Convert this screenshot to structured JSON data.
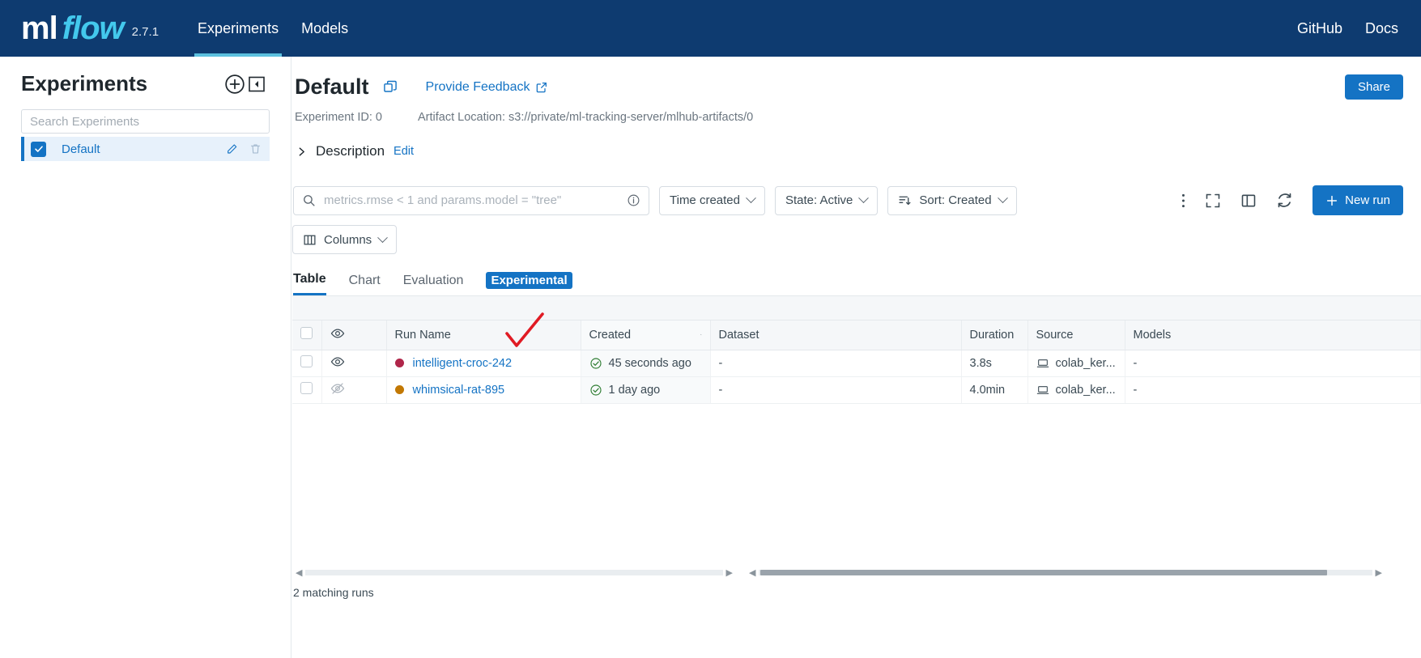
{
  "topbar": {
    "logo_ml": "ml",
    "logo_flow": "flow",
    "version": "2.7.1",
    "nav": [
      {
        "label": "Experiments",
        "icon": "experiments-icon",
        "active": true
      },
      {
        "label": "Models",
        "icon": "models-icon",
        "active": false
      }
    ],
    "right_links": [
      {
        "label": "GitHub",
        "icon": "github-link-icon"
      },
      {
        "label": "Docs",
        "icon": "docs-link-icon"
      }
    ],
    "background": "#0e3b70",
    "accent": "#43c9ed"
  },
  "sidebar": {
    "title": "Experiments",
    "create_icon": "plus-circle-icon",
    "collapse_icon": "collapse-sidebar-icon",
    "search_placeholder": "Search Experiments",
    "experiments": [
      {
        "name": "Default",
        "selected": true,
        "edit_icon": "pencil-icon",
        "delete_icon": "trash-icon"
      }
    ]
  },
  "main": {
    "title": "Default",
    "copy_icon": "copy-icon",
    "feedback_label": "Provide Feedback",
    "feedback_icon": "external-link-icon",
    "share_label": "Share",
    "experiment_id_label": "Experiment ID: 0",
    "artifact_location_label": "Artifact Location: s3://private/ml-tracking-server/mlhub-artifacts/0",
    "description_label": "Description",
    "description_edit_label": "Edit",
    "description_chevron": "chevron-right-icon"
  },
  "controls": {
    "search_placeholder": "metrics.rmse < 1 and params.model = \"tree\"",
    "search_icon": "search-icon",
    "info_icon": "info-circle-icon",
    "time_created_label": "Time created",
    "state_label": "State: Active",
    "sort_label": "Sort: Created",
    "sort_icon": "sort-descending-icon",
    "columns_label": "Columns",
    "columns_icon": "columns-icon",
    "more_icon": "more-vertical-icon",
    "fullscreen_icon": "fullscreen-icon",
    "panel_icon": "side-panel-icon",
    "refresh_icon": "refresh-icon",
    "new_run_label": "New run",
    "new_run_icon": "plus-icon",
    "accent_color": "#1473c4"
  },
  "tabs": [
    {
      "label": "Table",
      "active": true
    },
    {
      "label": "Chart",
      "active": false
    },
    {
      "label": "Evaluation",
      "active": false
    }
  ],
  "tabs_badge": "Experimental",
  "table": {
    "select_all_icon": "checkbox-icon",
    "visibility_icon": "eye-icon",
    "sort_indicator_icon": "sort-icon",
    "columns": [
      "Run Name",
      "Created",
      "Dataset",
      "Duration",
      "Source",
      "Models"
    ],
    "rows": [
      {
        "checkbox": "unchecked",
        "visibility": "eye-visible-icon",
        "dot_color": "#b0264a",
        "run_name": "intelligent-croc-242",
        "status_icon": "check-circle-icon",
        "created": "45 seconds ago",
        "dataset": "-",
        "duration": "3.8s",
        "source_icon": "laptop-icon",
        "source": "colab_ker...",
        "models": "-"
      },
      {
        "checkbox": "unchecked",
        "visibility": "eye-hidden-icon",
        "dot_color": "#c27803",
        "run_name": "whimsical-rat-895",
        "status_icon": "check-circle-icon",
        "created": "1 day ago",
        "dataset": "-",
        "duration": "4.0min",
        "source_icon": "laptop-icon",
        "source": "colab_ker...",
        "models": "-"
      }
    ],
    "footer": "2 matching runs"
  },
  "annotation": {
    "type": "red-checkmark",
    "color": "#e01b24"
  }
}
